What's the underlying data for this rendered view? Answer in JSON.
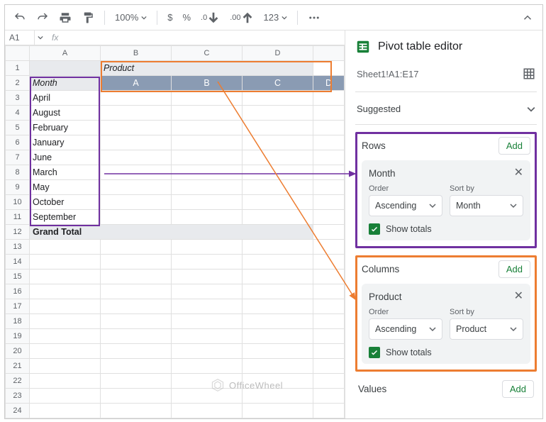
{
  "toolbar": {
    "zoom": "100%",
    "currency": "$",
    "percent": "%",
    "dec_dec": ".0",
    "dec_inc": ".00",
    "fmt_menu": "123"
  },
  "namebox": {
    "ref": "A1",
    "fx": "fx"
  },
  "grid": {
    "col_headers": [
      "A",
      "B",
      "C",
      "D"
    ],
    "product_label": "Product",
    "month_label": "Month",
    "pivot_cols": [
      "A",
      "B",
      "C",
      "D"
    ],
    "months": [
      "April",
      "August",
      "February",
      "January",
      "June",
      "March",
      "May",
      "October",
      "September"
    ],
    "grand_total": "Grand Total",
    "row_numbers": [
      "1",
      "2",
      "3",
      "4",
      "5",
      "6",
      "7",
      "8",
      "9",
      "10",
      "11",
      "12",
      "13",
      "14",
      "15",
      "16",
      "17",
      "18",
      "19",
      "20",
      "21",
      "22",
      "23",
      "24"
    ]
  },
  "panel": {
    "title": "Pivot table editor",
    "range": "Sheet1!A1:E17",
    "suggested": "Suggested",
    "rows_label": "Rows",
    "cols_label": "Columns",
    "values_label": "Values",
    "add": "Add",
    "order_label": "Order",
    "sortby_label": "Sort by",
    "show_totals": "Show totals",
    "row_field": {
      "name": "Month",
      "order": "Ascending",
      "sort_by": "Month"
    },
    "col_field": {
      "name": "Product",
      "order": "Ascending",
      "sort_by": "Product"
    }
  },
  "watermark": "OfficeWheel"
}
